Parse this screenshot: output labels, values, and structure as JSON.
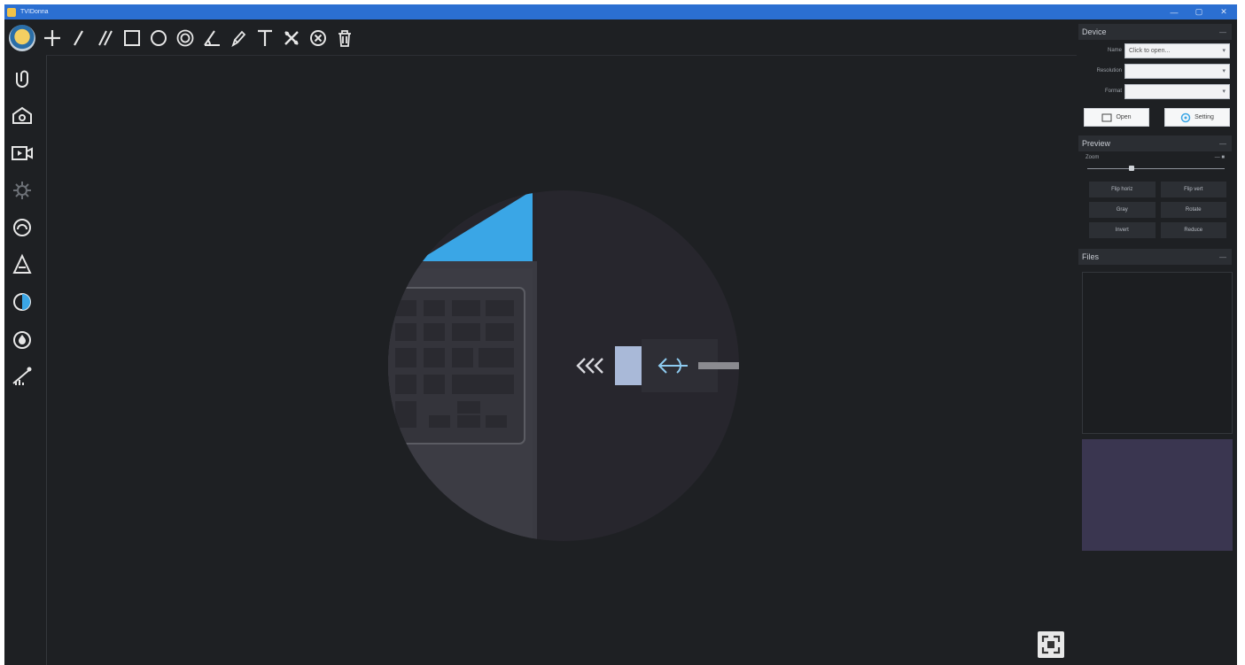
{
  "window": {
    "title": "TVIDonna",
    "controls": [
      "—",
      "▢",
      "✕"
    ]
  },
  "toolbar": {
    "tools": [
      {
        "name": "plus-icon"
      },
      {
        "name": "line-icon"
      },
      {
        "name": "parallel-lines-icon"
      },
      {
        "name": "rectangle-icon"
      },
      {
        "name": "circle-icon"
      },
      {
        "name": "concentric-circle-icon"
      },
      {
        "name": "angle-icon"
      },
      {
        "name": "pencil-icon"
      },
      {
        "name": "text-icon"
      },
      {
        "name": "eraser-icon"
      },
      {
        "name": "clear-icon"
      },
      {
        "name": "trash-icon"
      }
    ]
  },
  "sidebar": {
    "items": [
      {
        "name": "sidebar-capture-icon"
      },
      {
        "name": "sidebar-camera-icon"
      },
      {
        "name": "sidebar-video-icon"
      },
      {
        "name": "sidebar-settings-icon"
      },
      {
        "name": "sidebar-measure-icon"
      },
      {
        "name": "sidebar-triangle-icon"
      },
      {
        "name": "sidebar-contrast-icon"
      },
      {
        "name": "sidebar-drop-icon"
      },
      {
        "name": "sidebar-chart-icon"
      }
    ]
  },
  "colors": {
    "accent": "#3aa6e6",
    "titlebar": "#2b6fd1",
    "background": "#1e2023",
    "panel_section": "#2b2e33",
    "thumbnail": "#3a3650"
  },
  "panel": {
    "device": {
      "title": "Device",
      "rows": [
        {
          "label": "Name",
          "value": "Click to open..."
        },
        {
          "label": "Resolution",
          "value": ""
        },
        {
          "label": "Format",
          "value": ""
        }
      ],
      "open_button": "Open",
      "settings_button": "Setting"
    },
    "preview": {
      "title": "Preview",
      "zoom_label": "Zoom",
      "zoom_value": 0.3,
      "buttons": [
        "Flip horiz",
        "Flip vert",
        "Gray",
        "Rotate",
        "Invert",
        "Reduce"
      ]
    },
    "files": {
      "title": "Files"
    }
  }
}
